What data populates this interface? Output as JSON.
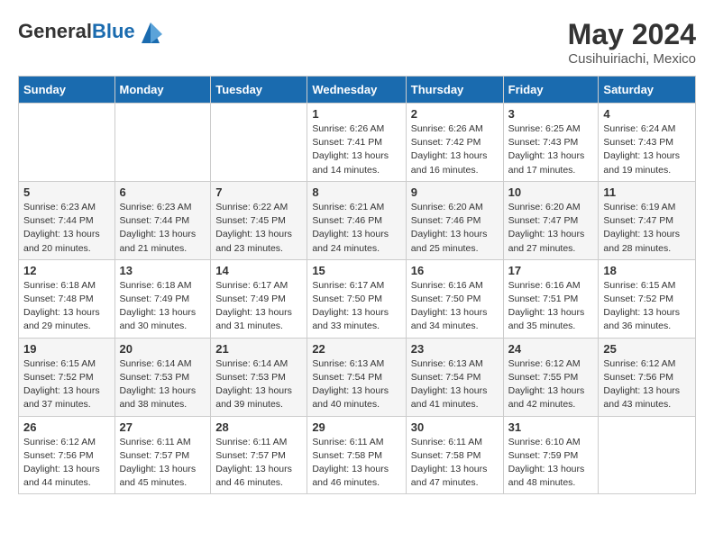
{
  "header": {
    "logo_general": "General",
    "logo_blue": "Blue",
    "title": "May 2024",
    "subtitle": "Cusihuiriachi, Mexico"
  },
  "weekdays": [
    "Sunday",
    "Monday",
    "Tuesday",
    "Wednesday",
    "Thursday",
    "Friday",
    "Saturday"
  ],
  "weeks": [
    [
      {
        "day": "",
        "info": ""
      },
      {
        "day": "",
        "info": ""
      },
      {
        "day": "",
        "info": ""
      },
      {
        "day": "1",
        "info": "Sunrise: 6:26 AM\nSunset: 7:41 PM\nDaylight: 13 hours and 14 minutes."
      },
      {
        "day": "2",
        "info": "Sunrise: 6:26 AM\nSunset: 7:42 PM\nDaylight: 13 hours and 16 minutes."
      },
      {
        "day": "3",
        "info": "Sunrise: 6:25 AM\nSunset: 7:43 PM\nDaylight: 13 hours and 17 minutes."
      },
      {
        "day": "4",
        "info": "Sunrise: 6:24 AM\nSunset: 7:43 PM\nDaylight: 13 hours and 19 minutes."
      }
    ],
    [
      {
        "day": "5",
        "info": "Sunrise: 6:23 AM\nSunset: 7:44 PM\nDaylight: 13 hours and 20 minutes."
      },
      {
        "day": "6",
        "info": "Sunrise: 6:23 AM\nSunset: 7:44 PM\nDaylight: 13 hours and 21 minutes."
      },
      {
        "day": "7",
        "info": "Sunrise: 6:22 AM\nSunset: 7:45 PM\nDaylight: 13 hours and 23 minutes."
      },
      {
        "day": "8",
        "info": "Sunrise: 6:21 AM\nSunset: 7:46 PM\nDaylight: 13 hours and 24 minutes."
      },
      {
        "day": "9",
        "info": "Sunrise: 6:20 AM\nSunset: 7:46 PM\nDaylight: 13 hours and 25 minutes."
      },
      {
        "day": "10",
        "info": "Sunrise: 6:20 AM\nSunset: 7:47 PM\nDaylight: 13 hours and 27 minutes."
      },
      {
        "day": "11",
        "info": "Sunrise: 6:19 AM\nSunset: 7:47 PM\nDaylight: 13 hours and 28 minutes."
      }
    ],
    [
      {
        "day": "12",
        "info": "Sunrise: 6:18 AM\nSunset: 7:48 PM\nDaylight: 13 hours and 29 minutes."
      },
      {
        "day": "13",
        "info": "Sunrise: 6:18 AM\nSunset: 7:49 PM\nDaylight: 13 hours and 30 minutes."
      },
      {
        "day": "14",
        "info": "Sunrise: 6:17 AM\nSunset: 7:49 PM\nDaylight: 13 hours and 31 minutes."
      },
      {
        "day": "15",
        "info": "Sunrise: 6:17 AM\nSunset: 7:50 PM\nDaylight: 13 hours and 33 minutes."
      },
      {
        "day": "16",
        "info": "Sunrise: 6:16 AM\nSunset: 7:50 PM\nDaylight: 13 hours and 34 minutes."
      },
      {
        "day": "17",
        "info": "Sunrise: 6:16 AM\nSunset: 7:51 PM\nDaylight: 13 hours and 35 minutes."
      },
      {
        "day": "18",
        "info": "Sunrise: 6:15 AM\nSunset: 7:52 PM\nDaylight: 13 hours and 36 minutes."
      }
    ],
    [
      {
        "day": "19",
        "info": "Sunrise: 6:15 AM\nSunset: 7:52 PM\nDaylight: 13 hours and 37 minutes."
      },
      {
        "day": "20",
        "info": "Sunrise: 6:14 AM\nSunset: 7:53 PM\nDaylight: 13 hours and 38 minutes."
      },
      {
        "day": "21",
        "info": "Sunrise: 6:14 AM\nSunset: 7:53 PM\nDaylight: 13 hours and 39 minutes."
      },
      {
        "day": "22",
        "info": "Sunrise: 6:13 AM\nSunset: 7:54 PM\nDaylight: 13 hours and 40 minutes."
      },
      {
        "day": "23",
        "info": "Sunrise: 6:13 AM\nSunset: 7:54 PM\nDaylight: 13 hours and 41 minutes."
      },
      {
        "day": "24",
        "info": "Sunrise: 6:12 AM\nSunset: 7:55 PM\nDaylight: 13 hours and 42 minutes."
      },
      {
        "day": "25",
        "info": "Sunrise: 6:12 AM\nSunset: 7:56 PM\nDaylight: 13 hours and 43 minutes."
      }
    ],
    [
      {
        "day": "26",
        "info": "Sunrise: 6:12 AM\nSunset: 7:56 PM\nDaylight: 13 hours and 44 minutes."
      },
      {
        "day": "27",
        "info": "Sunrise: 6:11 AM\nSunset: 7:57 PM\nDaylight: 13 hours and 45 minutes."
      },
      {
        "day": "28",
        "info": "Sunrise: 6:11 AM\nSunset: 7:57 PM\nDaylight: 13 hours and 46 minutes."
      },
      {
        "day": "29",
        "info": "Sunrise: 6:11 AM\nSunset: 7:58 PM\nDaylight: 13 hours and 46 minutes."
      },
      {
        "day": "30",
        "info": "Sunrise: 6:11 AM\nSunset: 7:58 PM\nDaylight: 13 hours and 47 minutes."
      },
      {
        "day": "31",
        "info": "Sunrise: 6:10 AM\nSunset: 7:59 PM\nDaylight: 13 hours and 48 minutes."
      },
      {
        "day": "",
        "info": ""
      }
    ]
  ]
}
